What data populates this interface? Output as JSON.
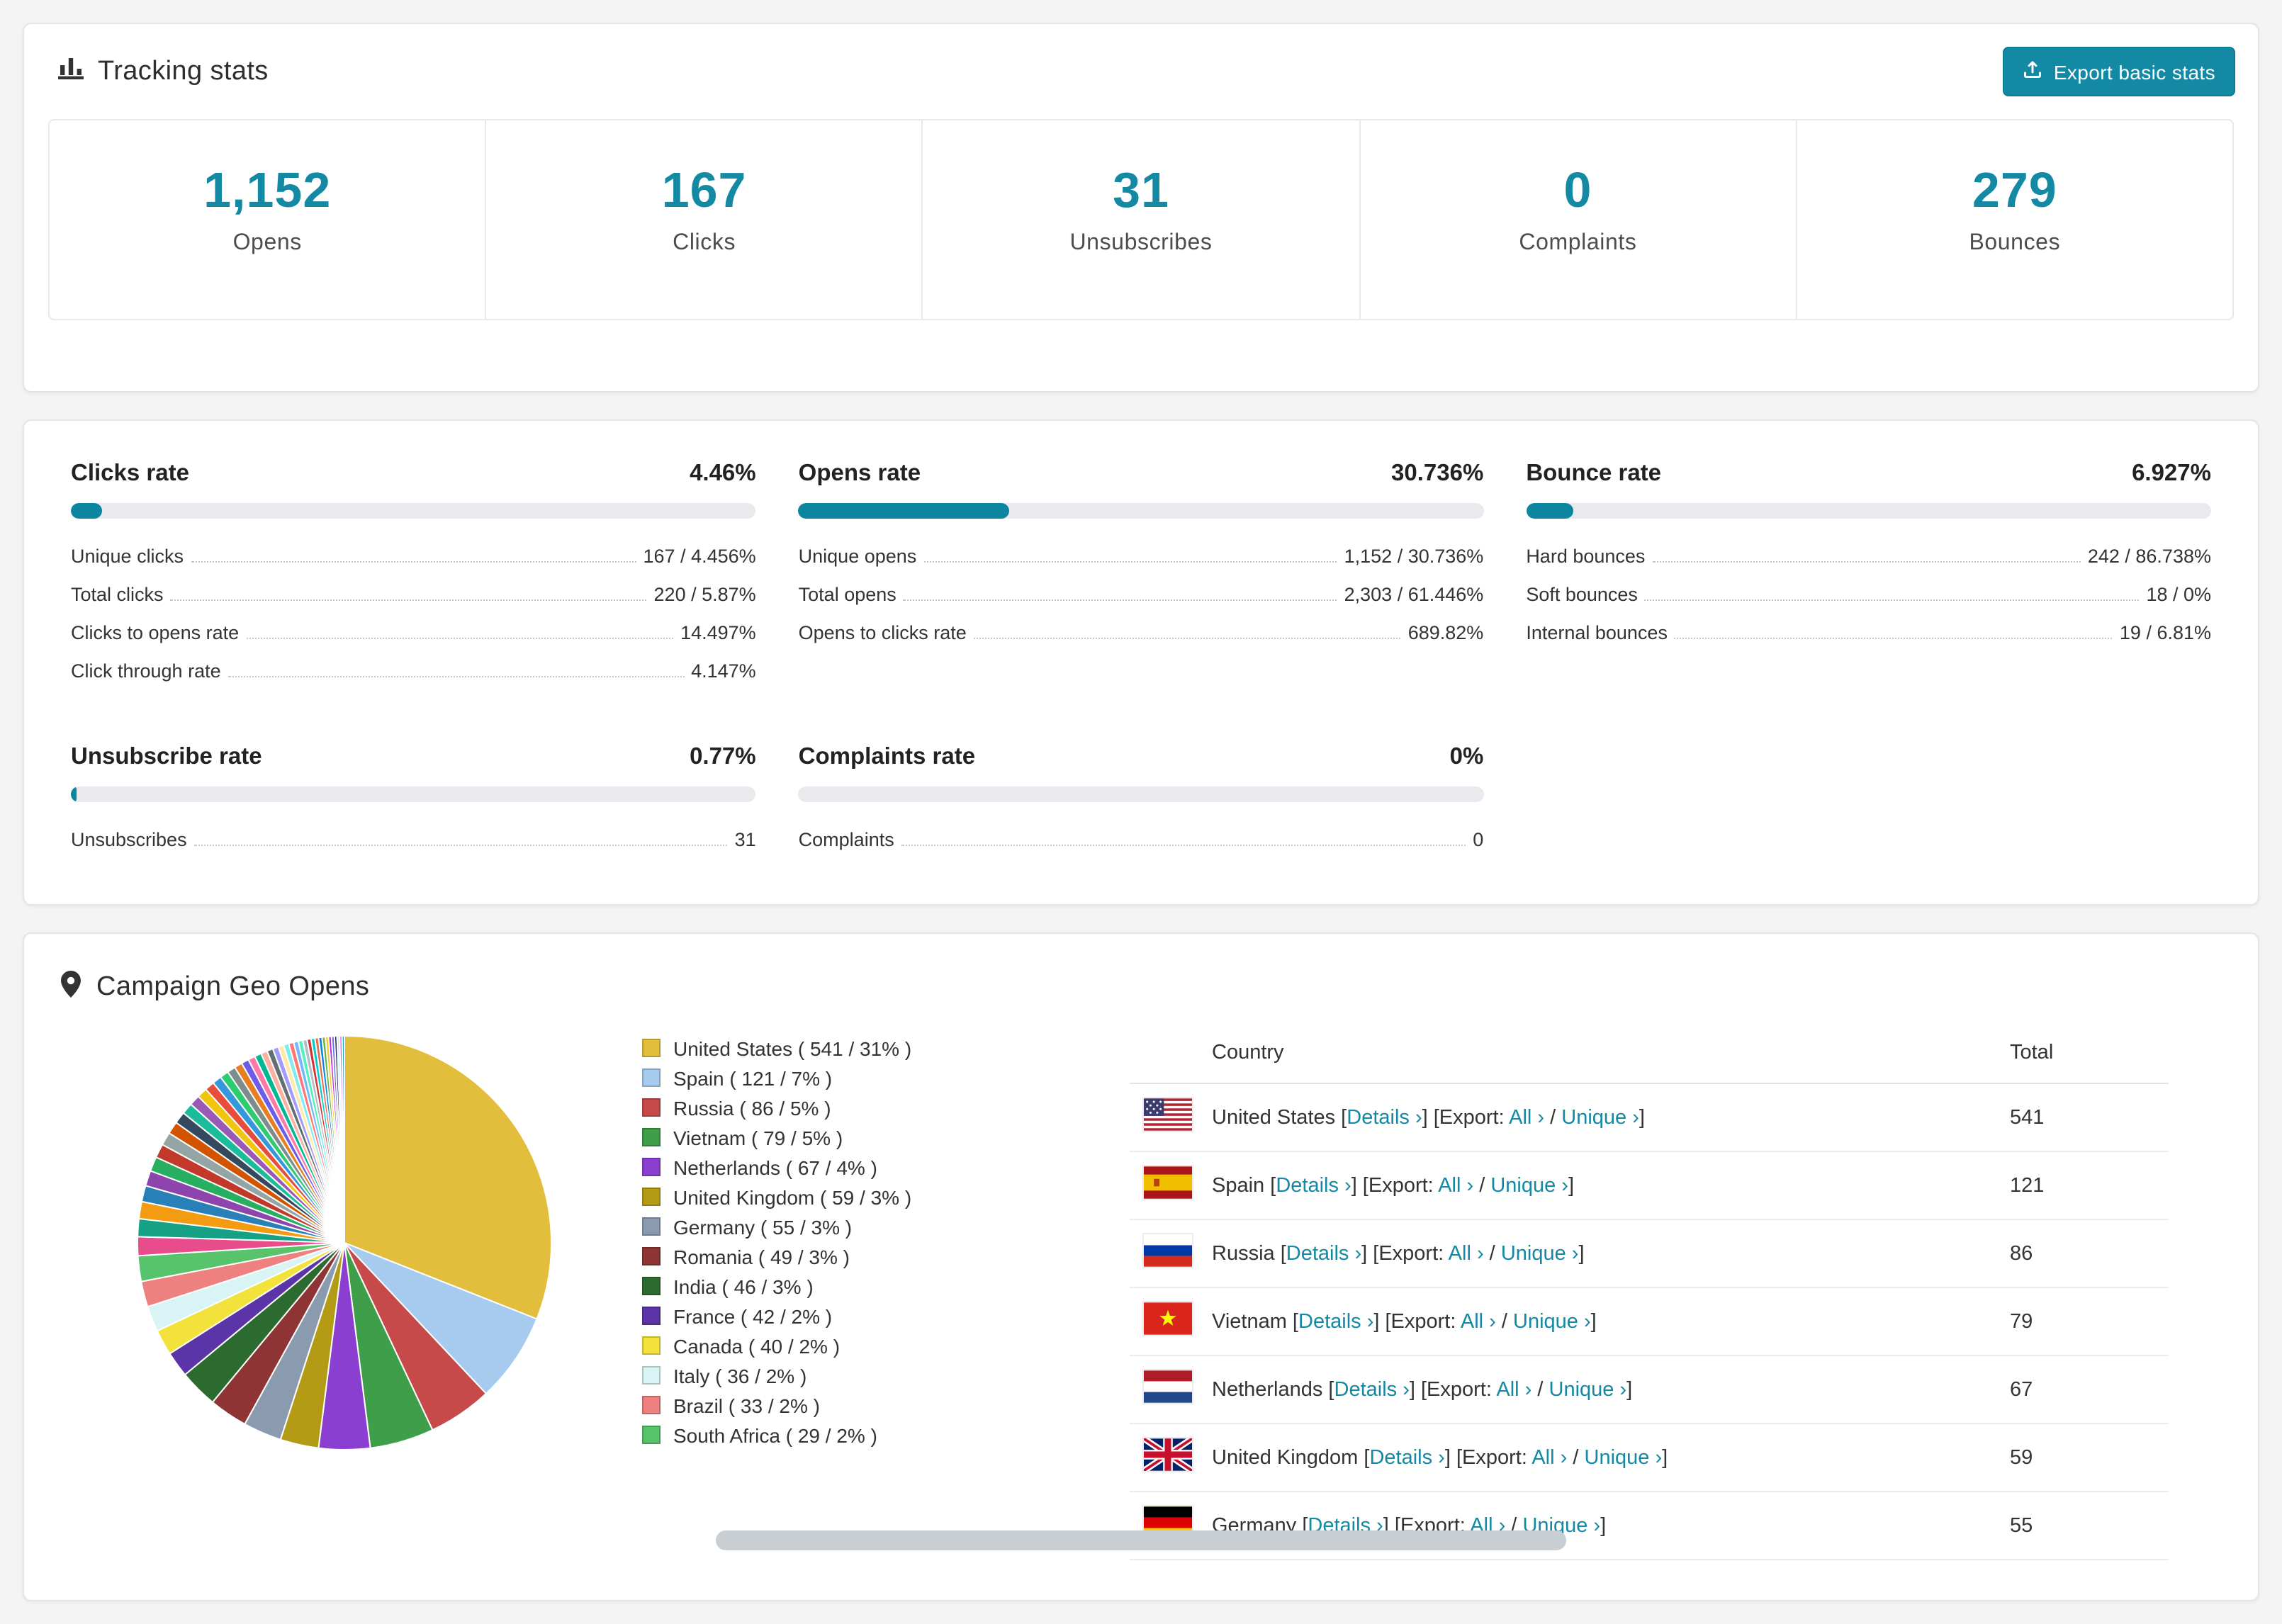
{
  "accent_color": "#1389A3",
  "icons": {
    "tracking_header": "bar-chart-icon",
    "export_button": "export-icon",
    "geo_header": "location-pin-icon"
  },
  "tracking": {
    "title": "Tracking stats",
    "export_label": "Export basic stats",
    "stats": [
      {
        "value": "1,152",
        "label": "Opens"
      },
      {
        "value": "167",
        "label": "Clicks"
      },
      {
        "value": "31",
        "label": "Unsubscribes"
      },
      {
        "value": "0",
        "label": "Complaints"
      },
      {
        "value": "279",
        "label": "Bounces"
      }
    ]
  },
  "rates": {
    "blocks": [
      {
        "title": "Clicks rate",
        "percent_label": "4.46%",
        "bar_percent": 4.46,
        "rows": [
          [
            "Unique clicks",
            "167 / 4.456%"
          ],
          [
            "Total clicks",
            "220 / 5.87%"
          ],
          [
            "Clicks to opens rate",
            "14.497%"
          ],
          [
            "Click through rate",
            "4.147%"
          ]
        ]
      },
      {
        "title": "Opens rate",
        "percent_label": "30.736%",
        "bar_percent": 30.736,
        "rows": [
          [
            "Unique opens",
            "1,152 / 30.736%"
          ],
          [
            "Total opens",
            "2,303 / 61.446%"
          ],
          [
            "Opens to clicks rate",
            "689.82%"
          ]
        ]
      },
      {
        "title": "Bounce rate",
        "percent_label": "6.927%",
        "bar_percent": 6.927,
        "rows": [
          [
            "Hard bounces",
            "242 / 86.738%"
          ],
          [
            "Soft bounces",
            "18 / 0%"
          ],
          [
            "Internal bounces",
            "19 / 6.81%"
          ]
        ]
      },
      {
        "title": "Unsubscribe rate",
        "percent_label": "0.77%",
        "bar_percent": 0.77,
        "rows": [
          [
            "Unsubscribes",
            "31"
          ]
        ]
      },
      {
        "title": "Complaints rate",
        "percent_label": "0%",
        "bar_percent": 0,
        "rows": [
          [
            "Complaints",
            "0"
          ]
        ]
      }
    ]
  },
  "geo": {
    "title": "Campaign Geo Opens",
    "table": {
      "country_header": "Country",
      "total_header": "Total",
      "details_label": "Details ›",
      "export_label": "Export:",
      "all_label": "All ›",
      "unique_label": "Unique ›",
      "rows": [
        {
          "country": "United States",
          "flag": "us",
          "total": "541"
        },
        {
          "country": "Spain",
          "flag": "es",
          "total": "121"
        },
        {
          "country": "Russia",
          "flag": "ru",
          "total": "86"
        },
        {
          "country": "Vietnam",
          "flag": "vn",
          "total": "79"
        },
        {
          "country": "Netherlands",
          "flag": "nl",
          "total": "67"
        },
        {
          "country": "United Kingdom",
          "flag": "gb",
          "total": "59"
        },
        {
          "country": "Germany",
          "flag": "de",
          "total": "55"
        }
      ]
    }
  },
  "chart_data": {
    "type": "pie",
    "title": "Campaign Geo Opens",
    "legend_position": "right",
    "start_angle_deg": 0,
    "direction": "clockwise",
    "slices": [
      {
        "label": "United States",
        "value": 541,
        "percent": 31,
        "color": "#E3BE3C"
      },
      {
        "label": "Spain",
        "value": 121,
        "percent": 7,
        "color": "#A6CBEE"
      },
      {
        "label": "Russia",
        "value": 86,
        "percent": 5,
        "color": "#C64A4A"
      },
      {
        "label": "Vietnam",
        "value": 79,
        "percent": 5,
        "color": "#3E9E4A"
      },
      {
        "label": "Netherlands",
        "value": 67,
        "percent": 4,
        "color": "#8A3FD1"
      },
      {
        "label": "United Kingdom",
        "value": 59,
        "percent": 3,
        "color": "#B49B16"
      },
      {
        "label": "Germany",
        "value": 55,
        "percent": 3,
        "color": "#8A9BB0"
      },
      {
        "label": "Romania",
        "value": 49,
        "percent": 3,
        "color": "#8E3434"
      },
      {
        "label": "India",
        "value": 46,
        "percent": 3,
        "color": "#2C6B2F"
      },
      {
        "label": "France",
        "value": 42,
        "percent": 2,
        "color": "#5B35A8"
      },
      {
        "label": "Canada",
        "value": 40,
        "percent": 2,
        "color": "#F2E23B"
      },
      {
        "label": "Italy",
        "value": 36,
        "percent": 2,
        "color": "#D8F4F4"
      },
      {
        "label": "Brazil",
        "value": 33,
        "percent": 2,
        "color": "#EE8080"
      },
      {
        "label": "South Africa",
        "value": 29,
        "percent": 2,
        "color": "#57C46B"
      }
    ],
    "other_slices": {
      "percent_total": 26,
      "count": 42,
      "colors": [
        "#E84C8B",
        "#16A085",
        "#F39C12",
        "#2980B9",
        "#8E44AD",
        "#27AE60",
        "#C0392B",
        "#95A5A6",
        "#D35400",
        "#34495E",
        "#1ABC9C",
        "#9B59B6",
        "#F1C40F",
        "#E74C3C",
        "#3498DB",
        "#2ECC71",
        "#7F8C8D",
        "#E67E22",
        "#6C5CE7",
        "#FD79A8",
        "#00B894",
        "#FAB1A0",
        "#636E72",
        "#A29BFE",
        "#FFEAA7",
        "#81ECEC",
        "#FF7675",
        "#74B9FF",
        "#55EFC4",
        "#B2BEC3",
        "#D63031",
        "#00CEC9",
        "#E17055",
        "#0984E3",
        "#6AB04C",
        "#F9CA24",
        "#BE2EDD",
        "#686DE0",
        "#30336B",
        "#C7ECEE",
        "#E056FD",
        "#22A6B3"
      ]
    }
  }
}
